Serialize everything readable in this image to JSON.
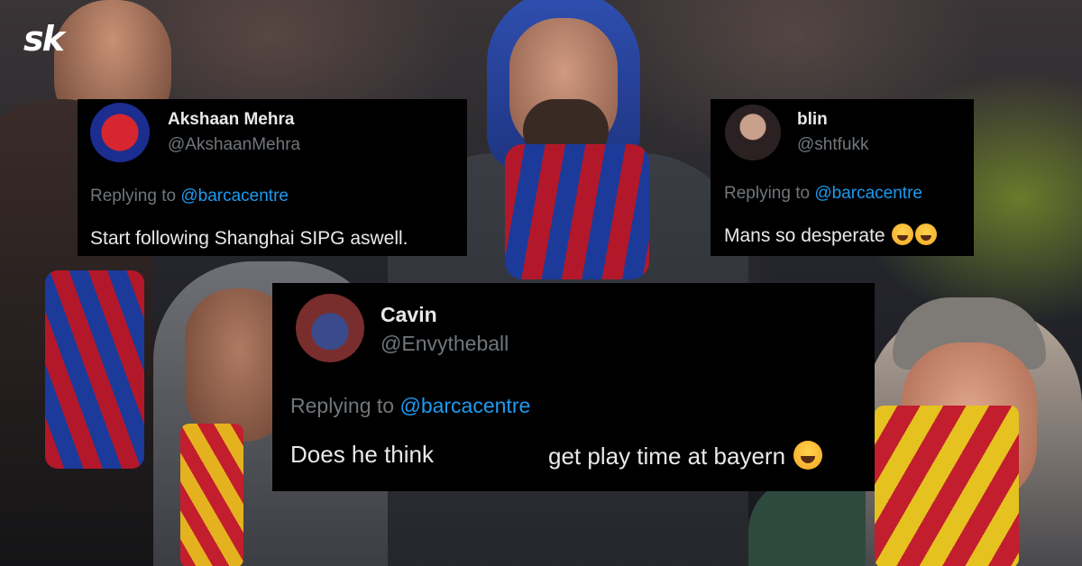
{
  "logo": {
    "text": "sk"
  },
  "tweets": [
    {
      "name": "Akshaan Mehra",
      "handle": "@AkshaanMehra",
      "replying_prefix": "Replying to ",
      "replying_to": "@barcacentre",
      "text": "Start following Shanghai SIPG aswell.",
      "emoji": ""
    },
    {
      "name": "blin",
      "handle": "@shtfukk",
      "replying_prefix": "Replying to ",
      "replying_to": "@barcacentre",
      "text": "Mans so desperate",
      "emoji": "loudly-crying-face x2"
    },
    {
      "name": "Cavin",
      "handle": "@Envytheball",
      "replying_prefix": "Replying to ",
      "replying_to": "@barcacentre",
      "text": "Does he think",
      "text_after_gap": "get play time at bayern",
      "emoji": "face-with-tears-of-joy"
    }
  ],
  "colors": {
    "card_bg": "#000000",
    "name": "#e7e9ea",
    "muted": "#71767b",
    "mention": "#1d9bf0"
  }
}
